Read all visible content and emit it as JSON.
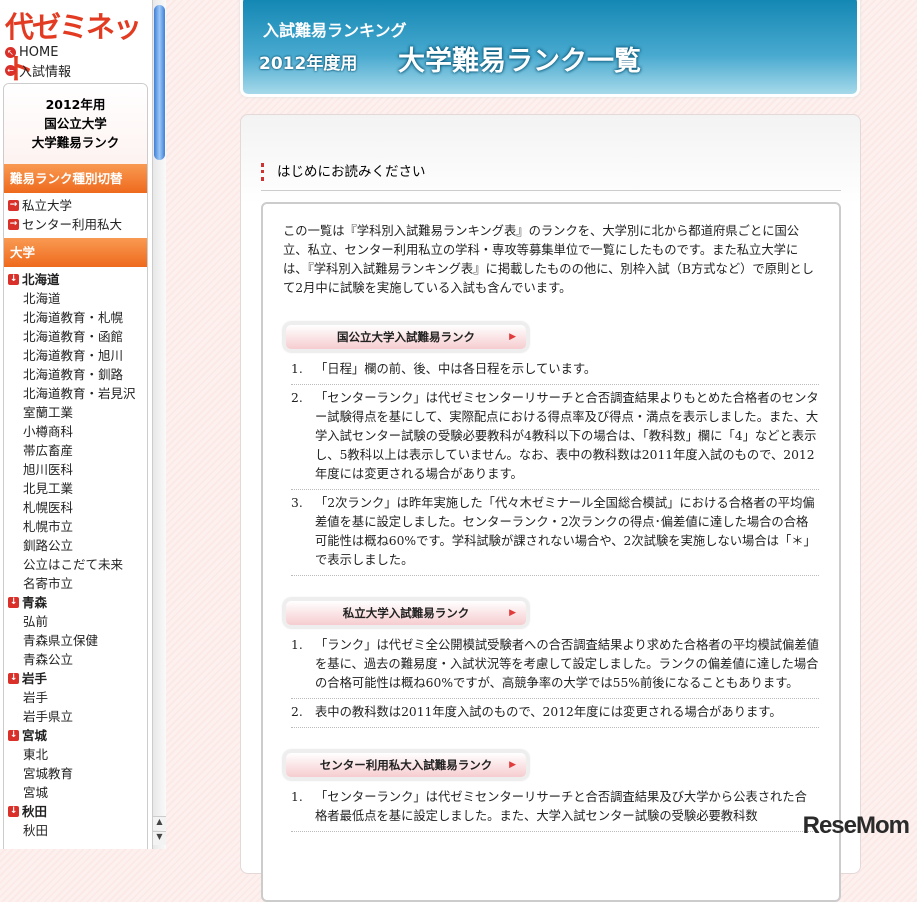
{
  "sidebar": {
    "logo": "代ゼミネット",
    "links": [
      "HOME",
      "入試情報"
    ],
    "panel_title": [
      "2012年用",
      "国公立大学",
      "大学難易ランク"
    ],
    "switch_header": "難易ランク種別切替",
    "switch_items": [
      "私立大学",
      "センター利用私大"
    ],
    "univ_header": "大学",
    "groups": [
      {
        "pref": "北海道",
        "items": [
          "北海道",
          "北海道教育・札幌",
          "北海道教育・函館",
          "北海道教育・旭川",
          "北海道教育・釧路",
          "北海道教育・岩見沢",
          "室蘭工業",
          "小樽商科",
          "帯広畜産",
          "旭川医科",
          "北見工業",
          "札幌医科",
          "札幌市立",
          "釧路公立",
          "公立はこだて未来",
          "名寄市立"
        ]
      },
      {
        "pref": "青森",
        "items": [
          "弘前",
          "青森県立保健",
          "青森公立"
        ]
      },
      {
        "pref": "岩手",
        "items": [
          "岩手",
          "岩手県立"
        ]
      },
      {
        "pref": "宮城",
        "items": [
          "東北",
          "宮城教育",
          "宮城"
        ]
      },
      {
        "pref": "秋田",
        "items": [
          "秋田"
        ]
      }
    ]
  },
  "banner": {
    "subtitle": "入試難易ランキング",
    "year": "2012年度用",
    "title": "大学難易ランク一覧"
  },
  "main": {
    "heading": "はじめにお読みください",
    "intro": "この一覧は『学科別入試難易ランキング表』のランクを、大学別に北から都道府県ごとに国公立、私立、センター利用私立の学科・専攻等募集単位で一覧にしたものです。また私立大学には、『学科別入試難易ランキング表』に掲載したものの他に、別枠入試（B方式など）で原則として2月中に試験を実施している入試も含んでいます。",
    "sections": [
      {
        "label": "国公立大学入試難易ランク",
        "items": [
          "「日程」欄の前、後、中は各日程を示しています。",
          "「センターランク」は代ゼミセンターリサーチと合否調査結果よりもとめた合格者のセンター試験得点を基にして、実際配点における得点率及び得点・満点を表示しました。また、大学入試センター試験の受験必要教科が4教科以下の場合は、「教科数」欄に「4」などと表示し、5教科以上は表示していません。なお、表中の教科数は2011年度入試のもので、2012年度には変更される場合があります。",
          "「2次ランク」は昨年実施した「代々木ゼミナール全国総合模試」における合格者の平均偏差値を基に設定しました。センターランク・2次ランクの得点･偏差値に達した場合の合格可能性は概ね60%です。学科試験が課されない場合や、2次試験を実施しない場合は「＊」で表示しました。"
        ]
      },
      {
        "label": "私立大学入試難易ランク",
        "items": [
          "「ランク」は代ゼミ全公開模試受験者への合否調査結果より求めた合格者の平均模試偏差値を基に、過去の難易度・入試状況等を考慮して設定しました。ランクの偏差値に達した場合の合格可能性は概ね60%ですが、高競争率の大学では55%前後になることもあります。",
          "表中の教科数は2011年度入試のもので、2012年度には変更される場合があります。"
        ]
      },
      {
        "label": "センター利用私大入試難易ランク",
        "items": [
          "「センターランク」は代ゼミセンターリサーチと合否調査結果及び大学から公表された合格者最低点を基に設定しました。また、大学入試センター試験の受験必要教科数"
        ]
      }
    ]
  },
  "watermark": "ReseMom"
}
